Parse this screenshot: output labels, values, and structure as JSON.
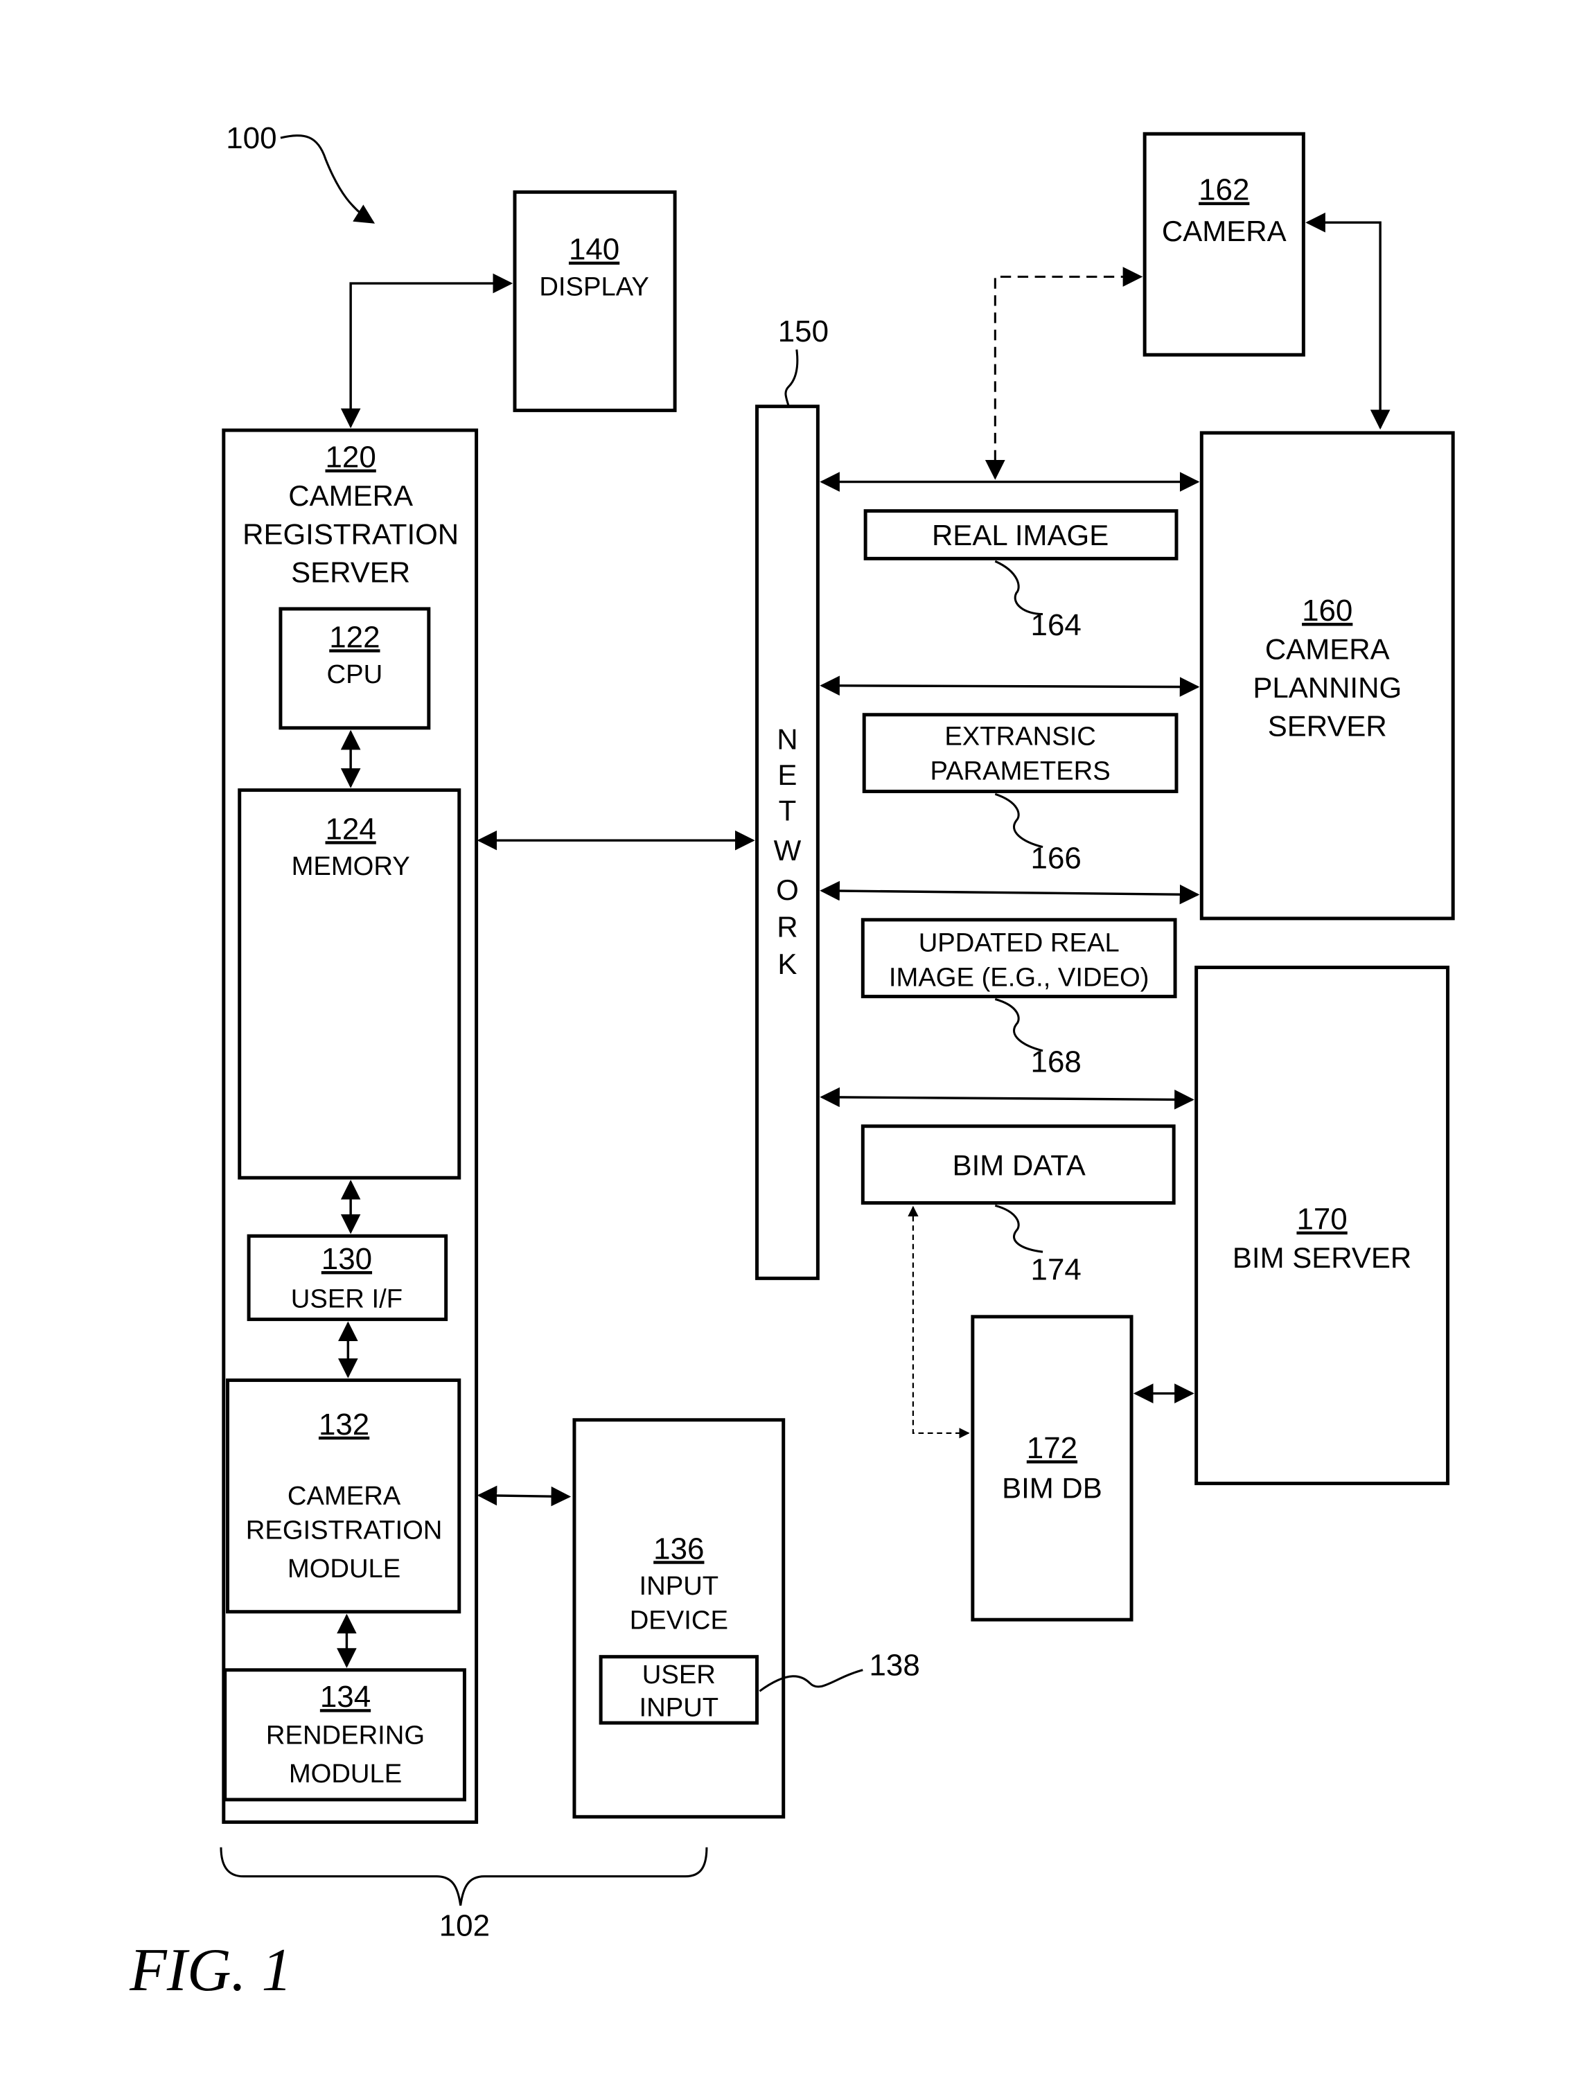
{
  "figure": {
    "caption": "FIG. 1",
    "system_ref": "100",
    "group_ref": "102"
  },
  "components": {
    "display": {
      "ref": "140",
      "label": "DISPLAY"
    },
    "camera_registration_server": {
      "ref": "120",
      "label_lines": [
        "CAMERA",
        "REGISTRATION",
        "SERVER"
      ]
    },
    "cpu": {
      "ref": "122",
      "label": "CPU"
    },
    "memory": {
      "ref": "124",
      "label": "MEMORY"
    },
    "user_if": {
      "ref": "130",
      "label": "USER I/F"
    },
    "camera_registration_module": {
      "ref": "132",
      "label_lines": [
        "CAMERA",
        "REGISTRATION",
        "MODULE"
      ]
    },
    "rendering_module": {
      "ref": "134",
      "label_lines": [
        "RENDERING",
        "MODULE"
      ]
    },
    "input_device": {
      "ref": "136",
      "label_lines": [
        "INPUT",
        "DEVICE"
      ]
    },
    "user_input": {
      "ref": "138",
      "label_lines": [
        "USER",
        "INPUT"
      ]
    },
    "network": {
      "ref": "150",
      "letters": [
        "N",
        "E",
        "T",
        "W",
        "O",
        "R",
        "K"
      ]
    },
    "camera": {
      "ref": "162",
      "label": "CAMERA"
    },
    "camera_planning_server": {
      "ref": "160",
      "label_lines": [
        "CAMERA",
        "PLANNING",
        "SERVER"
      ]
    },
    "real_image": {
      "ref": "164",
      "label": "REAL IMAGE"
    },
    "extransic_parameters": {
      "ref": "166",
      "label_lines": [
        "EXTRANSIC",
        "PARAMETERS"
      ]
    },
    "updated_real_image": {
      "ref": "168",
      "label_lines": [
        "UPDATED REAL",
        "IMAGE (E.G., VIDEO)"
      ]
    },
    "bim_server": {
      "ref": "170",
      "label": "BIM SERVER"
    },
    "bim_db": {
      "ref": "172",
      "label": "BIM DB"
    },
    "bim_data": {
      "ref": "174",
      "label": "BIM DATA"
    }
  }
}
